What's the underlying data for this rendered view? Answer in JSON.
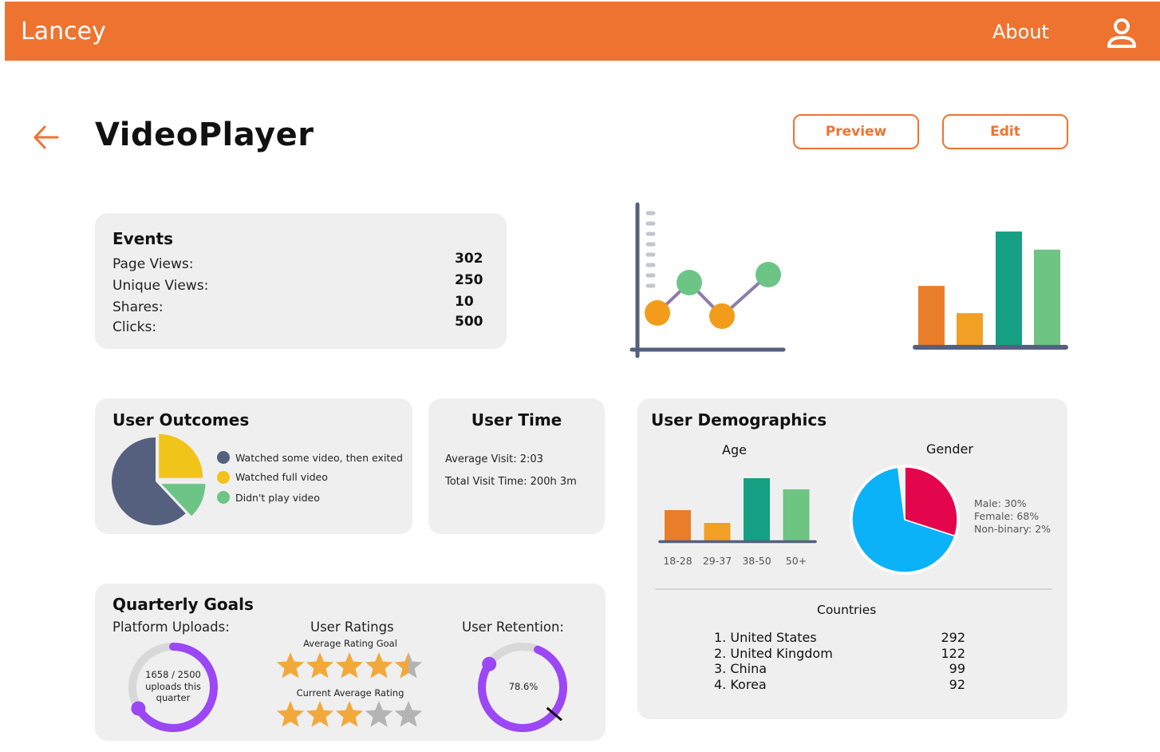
{
  "header": {
    "brand": "Lancey",
    "about_label": "About"
  },
  "page": {
    "title": "VideoPlayer",
    "preview_label": "Preview",
    "edit_label": "Edit"
  },
  "events": {
    "title": "Events",
    "rows": [
      {
        "label": "Page Views:",
        "value": "302"
      },
      {
        "label": "Unique Views:",
        "value": "250"
      },
      {
        "label": "Shares:",
        "value": "10"
      },
      {
        "label": "Clicks:",
        "value": "500"
      }
    ]
  },
  "user_outcomes": {
    "title": "User Outcomes",
    "legend": [
      {
        "label": "Watched some video, then exited",
        "color": "#55607f"
      },
      {
        "label": "Watched full video",
        "color": "#f0c419"
      },
      {
        "label": "Didn't play video",
        "color": "#6cc585"
      }
    ]
  },
  "user_time": {
    "title": "User Time",
    "average": "Average Visit: 2:03",
    "total": "Total Visit Time: 200h 3m"
  },
  "demographics": {
    "title": "User Demographics",
    "age_title": "Age",
    "gender_title": "Gender",
    "gender_stats": [
      "Male: 30%",
      "Female: 68%",
      "Non-binary: 2%"
    ],
    "countries_title": "Countries",
    "countries": [
      {
        "name": "1. United States",
        "value": "292"
      },
      {
        "name": "2. United Kingdom",
        "value": "122"
      },
      {
        "name": "3. China",
        "value": "99"
      },
      {
        "name": "4. Korea",
        "value": "92"
      }
    ]
  },
  "goals": {
    "title": "Quarterly Goals",
    "uploads_label": "Platform Uploads:",
    "uploads_text_1": "1658 / 2500",
    "uploads_text_2": "uploads this",
    "uploads_text_3": "quarter",
    "ratings_label": "User Ratings",
    "avg_goal_label": "Average Rating Goal",
    "current_label": "Current Average Rating",
    "retention_label": "User Retention:",
    "retention_value": "78.6%"
  },
  "chart_data": [
    {
      "type": "bar",
      "categories": [
        "18-28",
        "29-37",
        "38-50",
        "50+"
      ],
      "values": [
        38,
        22,
        78,
        64
      ],
      "colors": [
        "#e87d2a",
        "#f1a025",
        "#15a083",
        "#6ec482"
      ],
      "xlabel": "",
      "ylabel": "",
      "title": "Age",
      "ylim": [
        0,
        100
      ],
      "grid": false
    },
    {
      "type": "pie",
      "labels": [
        "Male",
        "Female",
        "Non-binary"
      ],
      "values": [
        30,
        68,
        2
      ],
      "colors": [
        "#e3064d",
        "#0bb2f8",
        "#f2f2f2"
      ],
      "title": "Gender"
    },
    {
      "type": "pie",
      "labels": [
        "Watched some video, then exited",
        "Watched full video",
        "Didn't play video"
      ],
      "values": [
        62,
        25,
        13
      ],
      "colors": [
        "#55607f",
        "#f0c419",
        "#6cc585"
      ]
    }
  ],
  "decor": {
    "line_points": [
      30,
      55,
      28,
      58
    ],
    "line_colors": [
      "#f39c1c",
      "#6cc585",
      "#f39c1c",
      "#6cc585"
    ],
    "bar_values": [
      52,
      28,
      100,
      84
    ],
    "bar_colors": [
      "#e87d2a",
      "#f1a025",
      "#15a083",
      "#6ec482"
    ]
  },
  "progress": {
    "uploads_fraction": 0.6632,
    "retention_fraction": 0.786,
    "rating_goal": 4.5,
    "rating_current": 3
  }
}
